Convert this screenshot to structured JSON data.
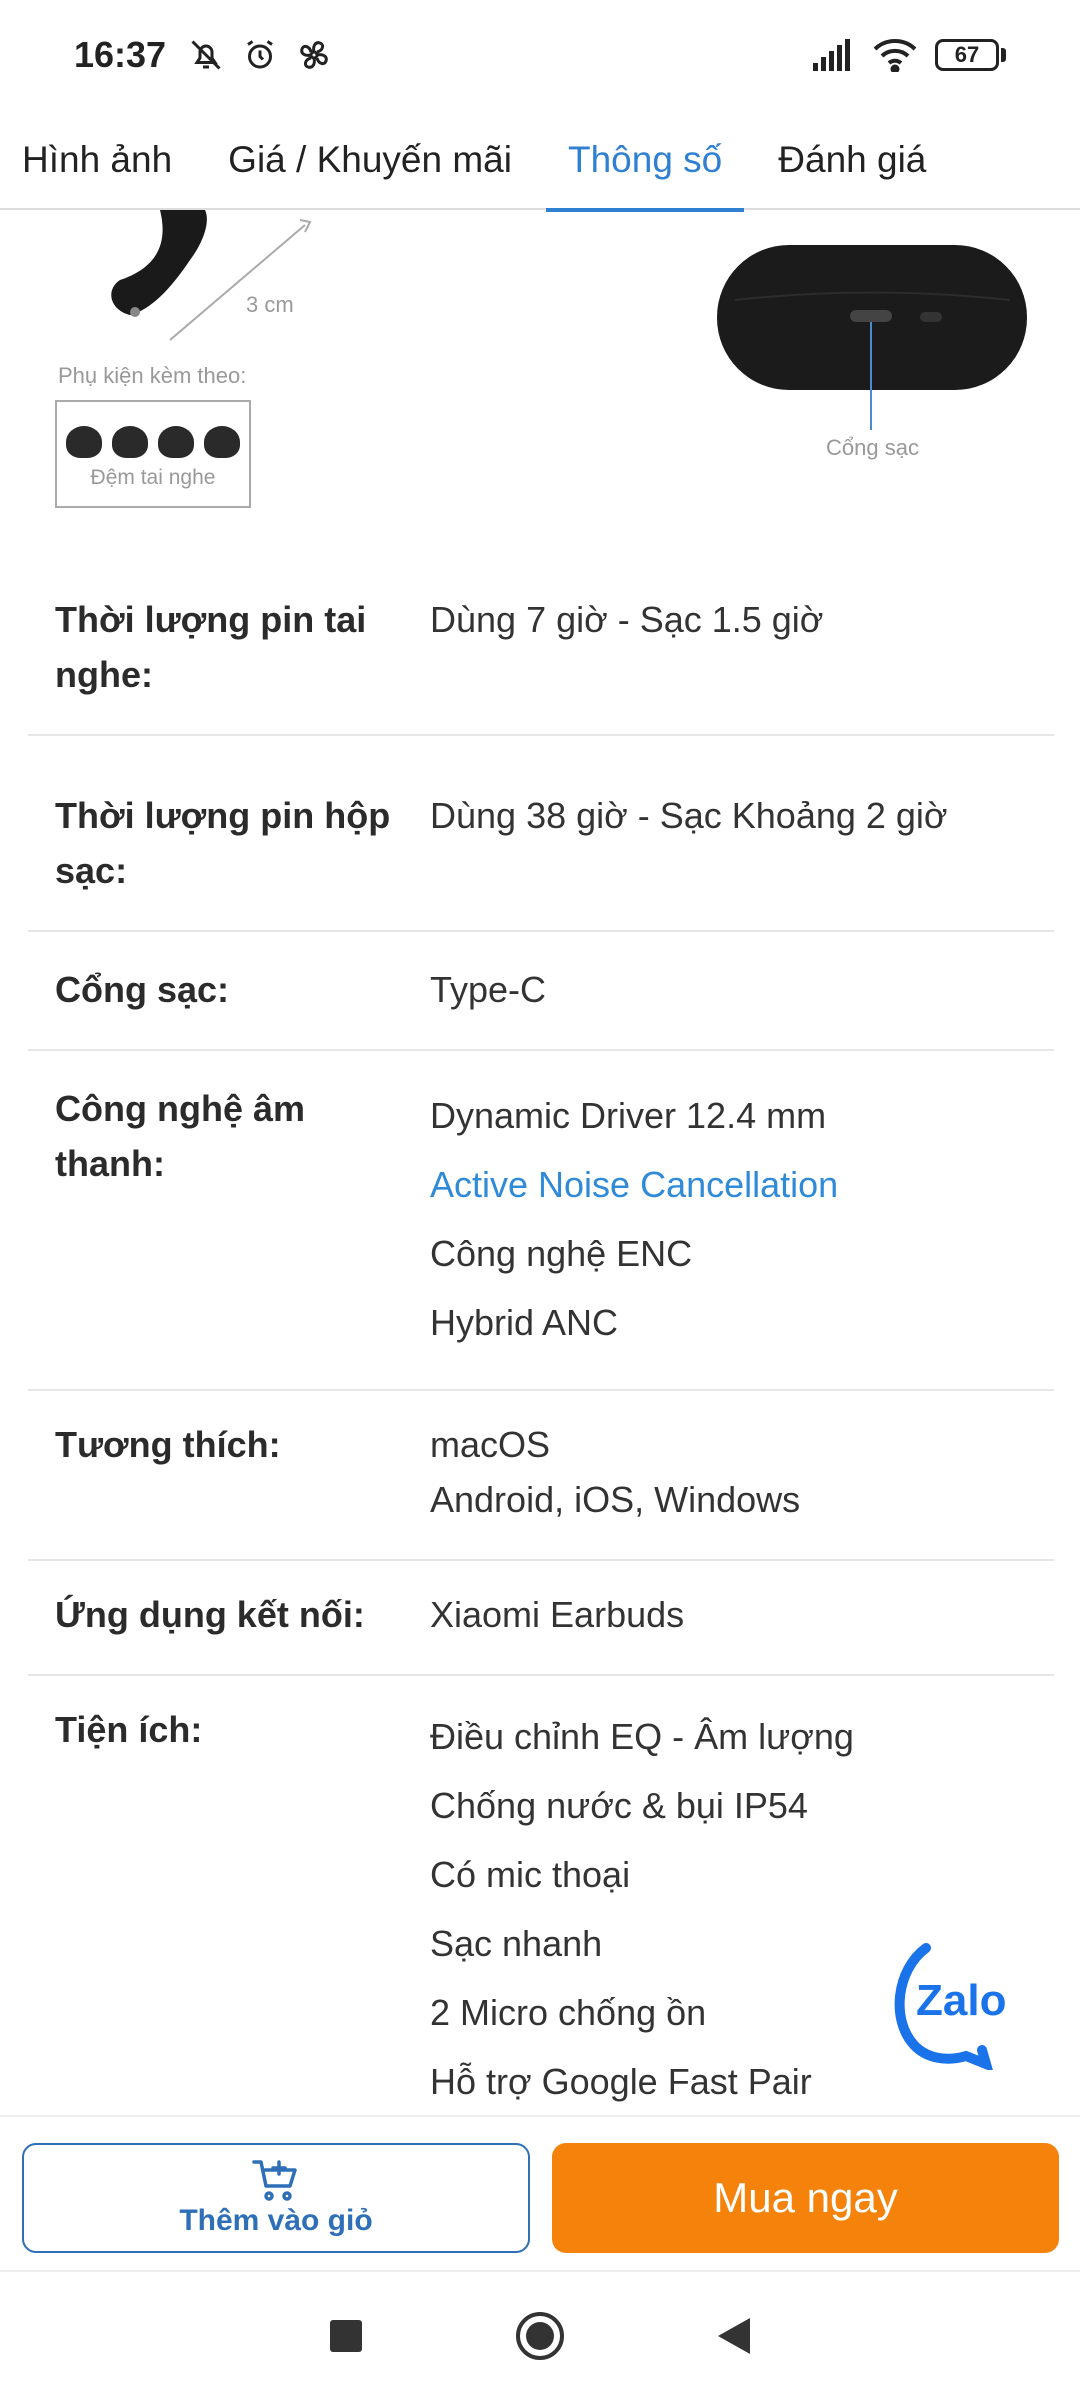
{
  "status": {
    "time": "16:37",
    "battery": "67"
  },
  "tabs": [
    {
      "label": "Hình ảnh"
    },
    {
      "label": "Giá / Khuyến mãi"
    },
    {
      "label": "Thông số"
    },
    {
      "label": "Đánh giá"
    }
  ],
  "product_image": {
    "dimension": "3 cm",
    "accessory_label": "Phụ kiện kèm theo:",
    "accessory_caption": "Đệm tai nghe",
    "port_label": "Cổng sạc"
  },
  "specs": [
    {
      "label": "Thời lượng pin tai nghe:",
      "values": [
        "Dùng 7 giờ - Sạc 1.5 giờ"
      ]
    },
    {
      "label": "Thời lượng pin hộp sạc:",
      "values": [
        "Dùng 38 giờ - Sạc Khoảng 2 giờ"
      ]
    },
    {
      "label": "Cổng sạc:",
      "values": [
        "Type-C"
      ]
    },
    {
      "label": "Công nghệ âm thanh:",
      "values": [
        "Dynamic Driver 12.4 mm",
        "Active Noise Cancellation",
        "Công nghệ ENC",
        "Hybrid ANC"
      ]
    },
    {
      "label": "Tương thích:",
      "values": [
        "macOS",
        "Android, iOS, Windows"
      ]
    },
    {
      "label": "Ứng dụng kết nối:",
      "values": [
        "Xiaomi Earbuds"
      ]
    },
    {
      "label": "Tiện ích:",
      "values": [
        "Điều chỉnh EQ - Âm lượng",
        "Chống nước & bụi IP54",
        "Có mic thoại",
        "Sạc nhanh",
        "2 Micro chống ồn",
        "Hỗ trợ Google Fast Pair"
      ]
    }
  ],
  "zalo": {
    "label": "Zalo"
  },
  "actions": {
    "add_to_cart": "Thêm vào giỏ",
    "buy_now": "Mua ngay"
  },
  "colors": {
    "accent": "#2f80d1",
    "buy": "#f5820a"
  }
}
